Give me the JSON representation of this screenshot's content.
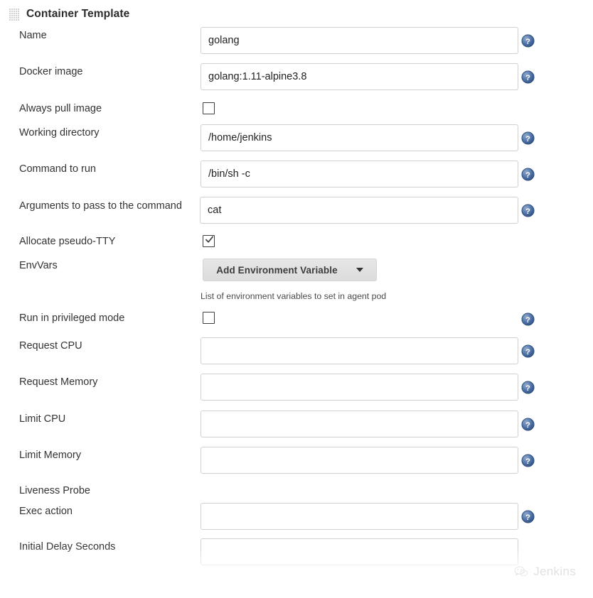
{
  "section": {
    "title": "Container Template",
    "drag_handle_icon": "drag-grid-icon"
  },
  "fields": [
    {
      "label": "Name",
      "type": "text",
      "value": "golang",
      "placeholder": "",
      "help": true
    },
    {
      "label": "Docker image",
      "type": "text",
      "value": "golang:1.11-alpine3.8",
      "placeholder": "",
      "help": true
    },
    {
      "label": "Always pull image",
      "type": "checkbox",
      "checked": false,
      "help": false
    },
    {
      "label": "Working directory",
      "type": "text",
      "value": "/home/jenkins",
      "placeholder": "",
      "help": true
    },
    {
      "label": "Command to run",
      "type": "text",
      "value": "/bin/sh -c",
      "placeholder": "",
      "help": true
    },
    {
      "label": "Arguments to pass to the command",
      "type": "text",
      "value": "cat",
      "placeholder": "",
      "help": true
    },
    {
      "label": "Allocate pseudo-TTY",
      "type": "checkbox",
      "checked": true,
      "help": false
    },
    {
      "label": "EnvVars",
      "type": "dropdown-button",
      "button_label": "Add Environment Variable",
      "caret_icon": "chevron-down-icon",
      "helper_text": "List of environment variables to set in agent pod",
      "help": false
    },
    {
      "label": "Run in privileged mode",
      "type": "checkbox",
      "checked": false,
      "help": true
    },
    {
      "label": "Request CPU",
      "type": "text",
      "value": "",
      "placeholder": "",
      "help": true
    },
    {
      "label": "Request Memory",
      "type": "text",
      "value": "",
      "placeholder": "",
      "help": true
    },
    {
      "label": "Limit CPU",
      "type": "text",
      "value": "",
      "placeholder": "",
      "help": true
    },
    {
      "label": "Limit Memory",
      "type": "text",
      "value": "",
      "placeholder": "",
      "help": true
    },
    {
      "label": "Liveness Probe",
      "type": "subsection",
      "help": false
    },
    {
      "label": "Exec action",
      "type": "text",
      "value": "",
      "placeholder": "",
      "help": true
    },
    {
      "label": "Initial Delay Seconds",
      "type": "text",
      "value": "",
      "placeholder": "",
      "help": false
    }
  ],
  "help_icon_name": "help-question-icon",
  "watermark": {
    "text": "Jenkins",
    "icon": "wechat-icon"
  },
  "colors": {
    "help_icon_blue": "#4a6fa5",
    "button_gray": "#e0e0e0",
    "input_border": "#d0d0d0",
    "text": "#333333"
  }
}
